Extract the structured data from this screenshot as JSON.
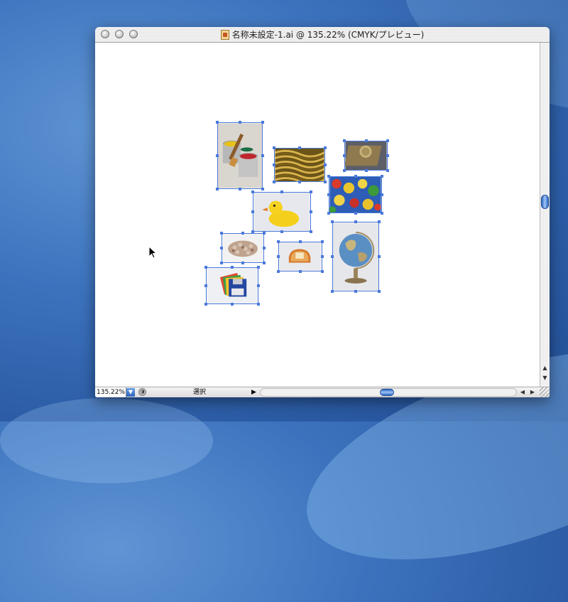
{
  "window": {
    "title": "名称未設定-1.ai @ 135.22% (CMYK/プレビュー)",
    "icon": "illustrator-document-icon"
  },
  "status_bar": {
    "zoom": "135.22%",
    "tool": "選択"
  },
  "canvas": {
    "images": [
      {
        "name": "paint-cans-image",
        "subject": "paint-cans"
      },
      {
        "name": "rope-image",
        "subject": "rope"
      },
      {
        "name": "coin-image",
        "subject": "coin"
      },
      {
        "name": "pushpins-image",
        "subject": "pushpins"
      },
      {
        "name": "rubber-duck-image",
        "subject": "rubber-duck"
      },
      {
        "name": "coins-pile-image",
        "subject": "coins-pile"
      },
      {
        "name": "toast-image",
        "subject": "toast"
      },
      {
        "name": "globe-image",
        "subject": "globe"
      },
      {
        "name": "floppy-disks-image",
        "subject": "floppy-disks"
      }
    ]
  },
  "colors": {
    "selection": "#4a79db",
    "desktop": "#3c72bd",
    "scroll_thumb": "#2f67c0"
  }
}
